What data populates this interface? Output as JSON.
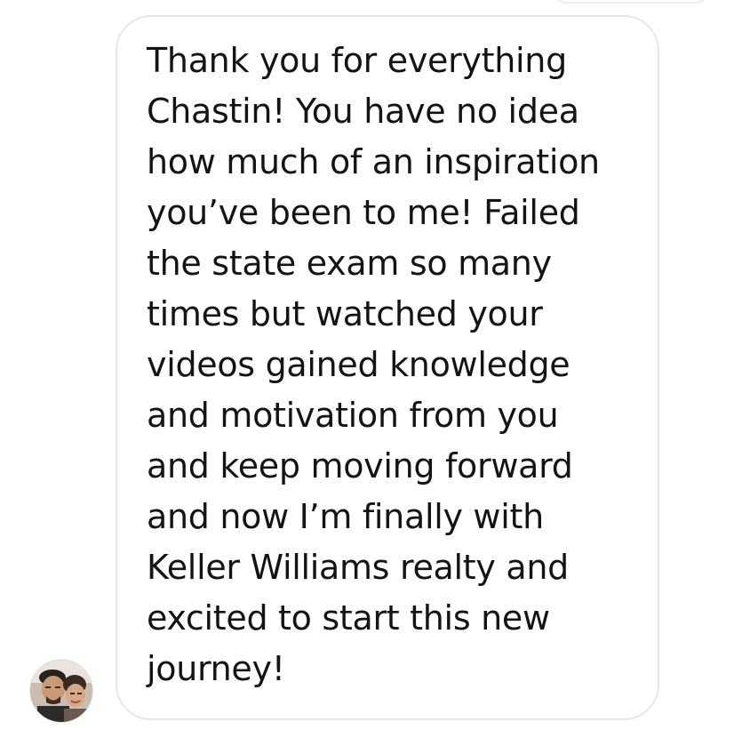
{
  "chat": {
    "message": {
      "lines": [
        "Thank you for everything",
        "Chastin! You have no idea",
        "how much of an inspiration",
        "you’ve been to me! Failed",
        "the state exam so many",
        "times but watched your",
        "videos gained knowledge",
        "and motivation from you",
        "and keep moving forward",
        "and now I’m finally with",
        "Keller Williams realty and",
        "excited to start this new",
        "journey!"
      ]
    },
    "avatar": {
      "icon": "avatar-photo"
    }
  },
  "colors": {
    "text": "#141414",
    "bubble_border": "#e6e6e6",
    "background": "#ffffff"
  }
}
